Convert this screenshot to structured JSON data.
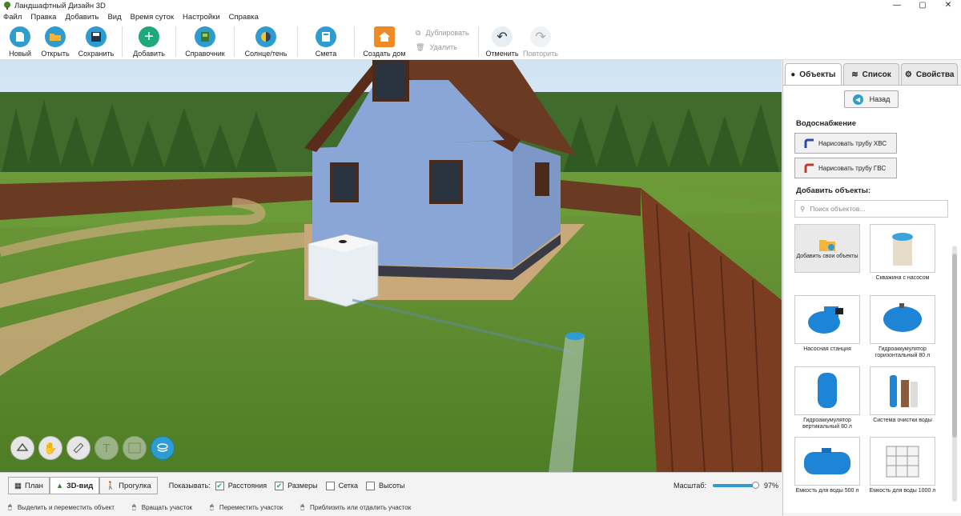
{
  "window": {
    "title": "Ландшафтный Дизайн 3D",
    "min": "—",
    "max": "▢",
    "close": "✕"
  },
  "menu": [
    "Файл",
    "Правка",
    "Добавить",
    "Вид",
    "Время суток",
    "Настройки",
    "Справка"
  ],
  "toolbar": {
    "new": "Новый",
    "open": "Открыть",
    "save": "Сохранить",
    "add": "Добавить",
    "reference": "Справочник",
    "sun": "Солнце/тень",
    "estimate": "Смета",
    "create_house": "Создать дом",
    "duplicate": "Дублировать",
    "delete": "Удалить",
    "undo": "Отменить",
    "redo": "Повторить"
  },
  "panel": {
    "tabs": [
      "Объекты",
      "Список",
      "Свойства"
    ],
    "back": "Назад",
    "water_title": "Водоснабжение",
    "cold_pipe": "Нарисовать трубу ХВС",
    "hot_pipe": "Нарисовать трубу ГВС",
    "add_objects": "Добавить объекты:",
    "search_placeholder": "Поиск объектов...",
    "items": [
      {
        "label": "Добавить свои объекты",
        "icon": "folder-add-icon"
      },
      {
        "label": "Скважина с насосом",
        "icon": "well-icon"
      },
      {
        "label": "Насосная станция",
        "icon": "pump-station-icon"
      },
      {
        "label": "Гидроаккумулятор горизонтальный 80 л",
        "icon": "tank-horizontal-icon"
      },
      {
        "label": "Гидроаккумулятор вертикальный 80 л",
        "icon": "tank-vertical-icon"
      },
      {
        "label": "Система очистки воды",
        "icon": "filter-icon"
      },
      {
        "label": "Емкость для воды 500 л",
        "icon": "water-tank-icon"
      },
      {
        "label": "Емкость для воды 1000 л",
        "icon": "ibc-tank-icon"
      }
    ]
  },
  "bottom": {
    "plan": "План",
    "view3d": "3D-вид",
    "walk": "Прогулка",
    "show": "Показывать:",
    "distances": "Расстояния",
    "sizes": "Размеры",
    "grid": "Сетка",
    "heights": "Высоты",
    "scale": "Масштаб:",
    "scale_value": "97%",
    "scale_level": 0.97
  },
  "status": [
    "Выделить и переместить объект",
    "Вращать участок",
    "Переместить участок",
    "Приблизить или отдалить участок"
  ],
  "colors": {
    "accent": "#2e9bd1",
    "grass": "#5f8a2f",
    "house": "#8aa6d6"
  }
}
